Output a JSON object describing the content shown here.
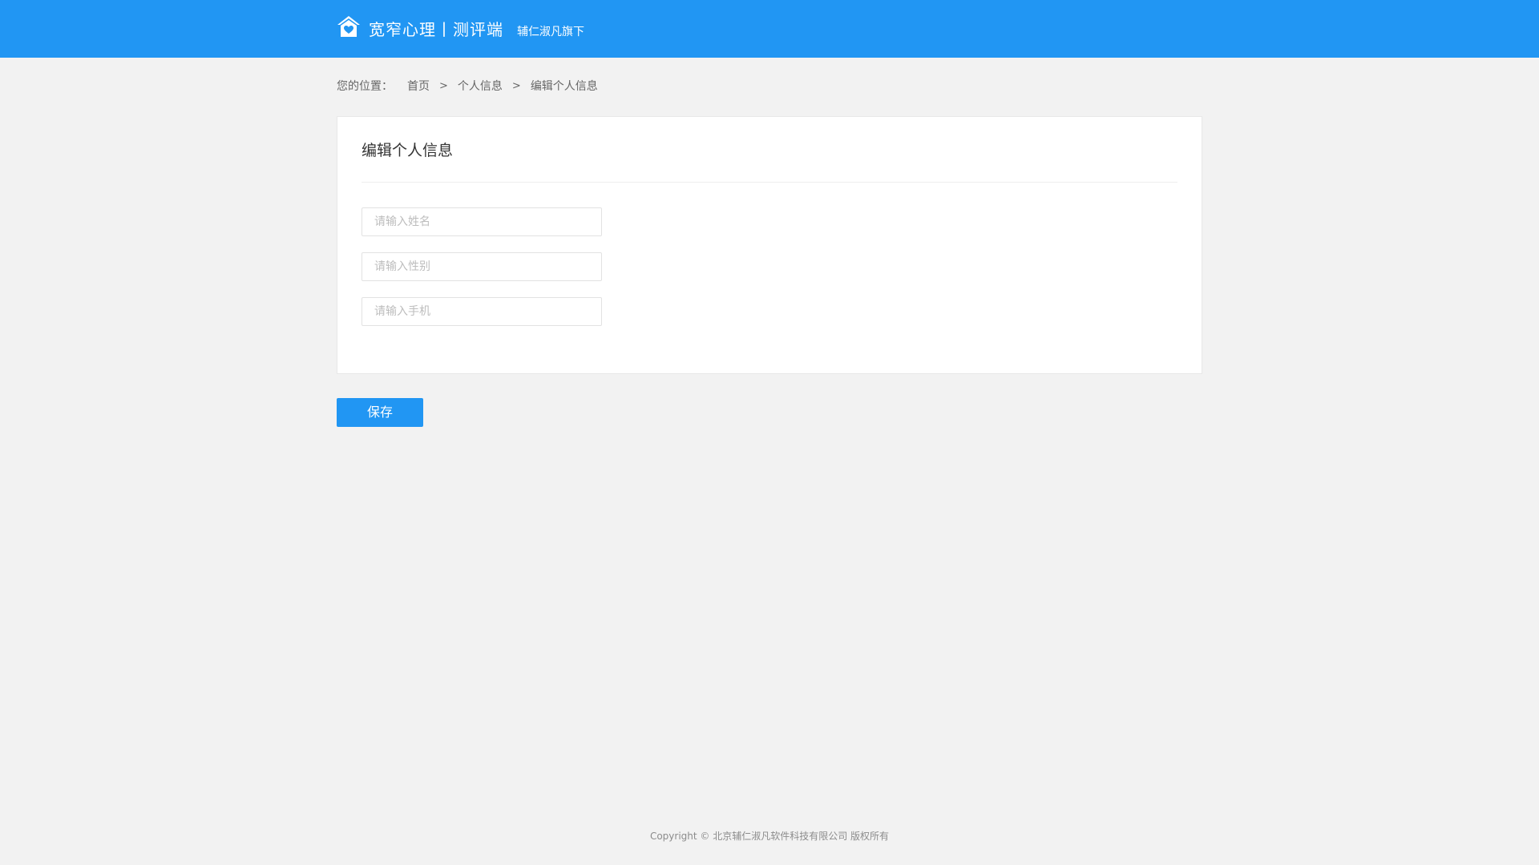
{
  "header": {
    "logo_icon": "house-heart-icon",
    "brand_title": "宽窄心理丨测评端",
    "sub_brand": "辅仁淑凡旗下",
    "accent_color": "#2196f3"
  },
  "breadcrumb": {
    "prefix": "您的位置：",
    "items": [
      {
        "label": "首页"
      },
      {
        "label": "个人信息"
      },
      {
        "label": "编辑个人信息"
      }
    ],
    "separator": ">"
  },
  "form": {
    "title": "编辑个人信息",
    "fields": [
      {
        "placeholder": "请输入姓名",
        "value": ""
      },
      {
        "placeholder": "请输入性别",
        "value": ""
      },
      {
        "placeholder": "请输入手机",
        "value": ""
      }
    ],
    "save_label": "保存"
  },
  "footer": {
    "copyright": "Copyright © 北京辅仁淑凡软件科技有限公司 版权所有"
  }
}
